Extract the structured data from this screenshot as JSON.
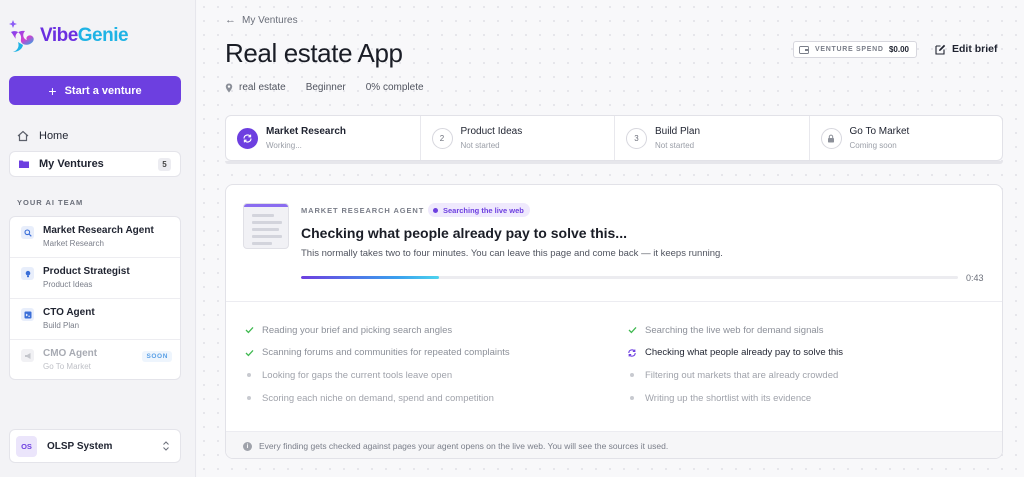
{
  "brand": {
    "part1": "Vibe",
    "part2": "Genie"
  },
  "sidebar": {
    "start_label": "Start a venture",
    "home_label": "Home",
    "ventures_label": "My Ventures",
    "ventures_count": "5",
    "team_heading": "YOUR AI TEAM",
    "agents": [
      {
        "name": "Market Research Agent",
        "sub": "Market Research",
        "icon": "search-icon"
      },
      {
        "name": "Product Strategist",
        "sub": "Product Ideas",
        "icon": "bulb-icon"
      },
      {
        "name": "CTO Agent",
        "sub": "Build Plan",
        "icon": "code-icon"
      },
      {
        "name": "CMO Agent",
        "sub": "Go To Market",
        "icon": "megaphone-icon",
        "badge": "SOON"
      }
    ],
    "system": {
      "badge": "OS",
      "label": "OLSP System"
    }
  },
  "header": {
    "back_label": "My Ventures",
    "title": "Real estate App",
    "meta": {
      "category": "real estate",
      "level": "Beginner",
      "progress": "0% complete"
    },
    "spend_label": "VENTURE SPEND",
    "spend_amount": "$0.00",
    "edit_label": "Edit brief"
  },
  "tabs": [
    {
      "num": "",
      "label": "Market Research",
      "status": "Working...",
      "active": true
    },
    {
      "num": "2",
      "label": "Product Ideas",
      "status": "Not started"
    },
    {
      "num": "3",
      "label": "Build Plan",
      "status": "Not started"
    },
    {
      "num": "",
      "label": "Go To Market",
      "status": "Coming soon",
      "locked": true
    }
  ],
  "card": {
    "agent_label": "MARKET RESEARCH AGENT",
    "live_label": "Searching the live web",
    "headline": "Checking what people already pay to solve this...",
    "subtext": "This normally takes two to four minutes. You can leave this page and come back — it keeps running.",
    "progress": 0.21,
    "timer": "0:43",
    "steps_left": [
      {
        "text": "Reading your brief and picking search angles",
        "state": "done"
      },
      {
        "text": "Scanning forums and communities for repeated complaints",
        "state": "done"
      },
      {
        "text": "Looking for gaps the current tools leave open",
        "state": "todo"
      },
      {
        "text": "Scoring each niche on demand, spend and competition",
        "state": "todo"
      }
    ],
    "steps_right": [
      {
        "text": "Searching the live web for demand signals",
        "state": "done"
      },
      {
        "text": "Checking what people already pay to solve this",
        "state": "current"
      },
      {
        "text": "Filtering out markets that are already crowded",
        "state": "todo"
      },
      {
        "text": "Writing up the shortlist with its evidence",
        "state": "todo"
      }
    ],
    "footer": "Every finding gets checked against pages your agent opens on the live web. You will see the sources it used."
  },
  "colors": {
    "accent": "#6d3fe0",
    "brand_cyan": "#1fb3e5",
    "check": "#3fb950"
  }
}
